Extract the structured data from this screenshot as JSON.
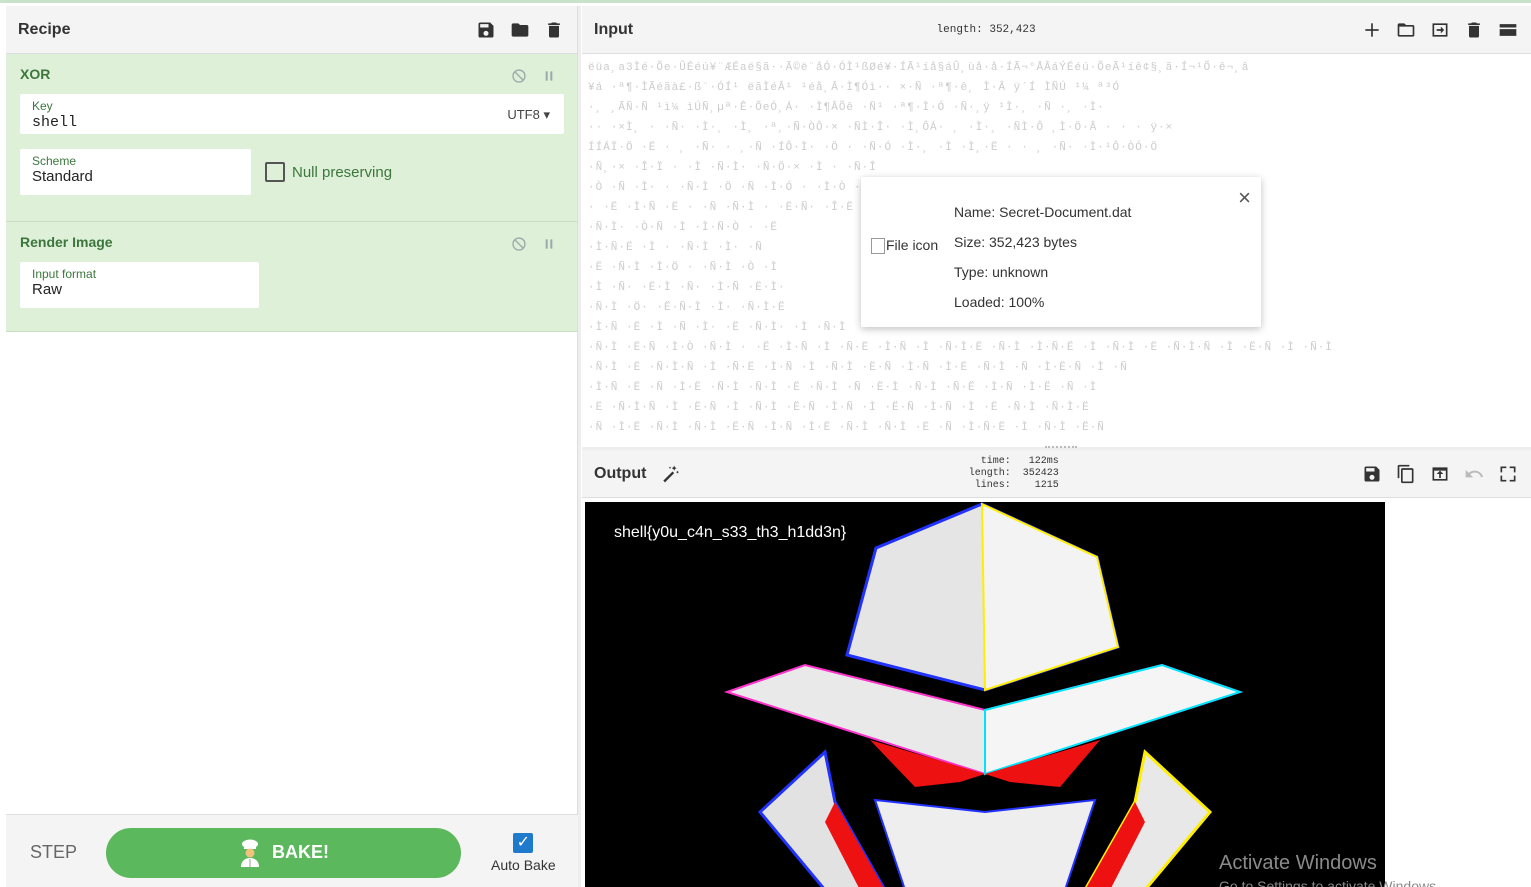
{
  "recipe": {
    "title": "Recipe",
    "icons": [
      "save-icon",
      "folder-icon",
      "trash-icon"
    ],
    "operations": [
      {
        "name": "XOR",
        "key": {
          "label": "Key",
          "value": "shell",
          "encoding": "UTF8"
        },
        "scheme": {
          "label": "Scheme",
          "value": "Standard"
        },
        "null_preserving": {
          "label": "Null preserving",
          "checked": false
        }
      },
      {
        "name": "Render Image",
        "input_format": {
          "label": "Input format",
          "value": "Raw"
        }
      }
    ],
    "footer": {
      "step_label": "STEP",
      "bake_label": "BAKE!",
      "auto_bake_label": "Auto Bake",
      "auto_bake_checked": true
    }
  },
  "input": {
    "title": "Input",
    "length_label": "length:",
    "length_value": "352,423",
    "icons": [
      "plus-icon",
      "folder-icon",
      "import-icon",
      "trash-icon",
      "layout-icon"
    ],
    "file": {
      "icon_alt": "File icon",
      "name": "Name: Secret-Document.dat",
      "size": "Size: 352,423 bytes",
      "type": "Type: unknown",
      "loaded": "Loaded: 100%"
    }
  },
  "output": {
    "title": "Output",
    "time_label": "time:",
    "time_value": "122ms",
    "length_label": "length:",
    "length_value": "352423",
    "lines_label": "lines:",
    "lines_value": "1215",
    "flag": "shell{y0u_c4n_s33_th3_h1dd3n}",
    "icons": [
      "save-icon",
      "copy-icon",
      "replace-input-icon",
      "undo-icon",
      "maximize-icon"
    ]
  },
  "watermark": {
    "line1": "Activate Windows",
    "line2": "Go to Settings to activate Windows."
  },
  "colors": {
    "accent_green": "#5cb85c",
    "op_bg": "#dff0d8",
    "op_text": "#3c763d",
    "checkbox_blue": "#1f7acc"
  }
}
